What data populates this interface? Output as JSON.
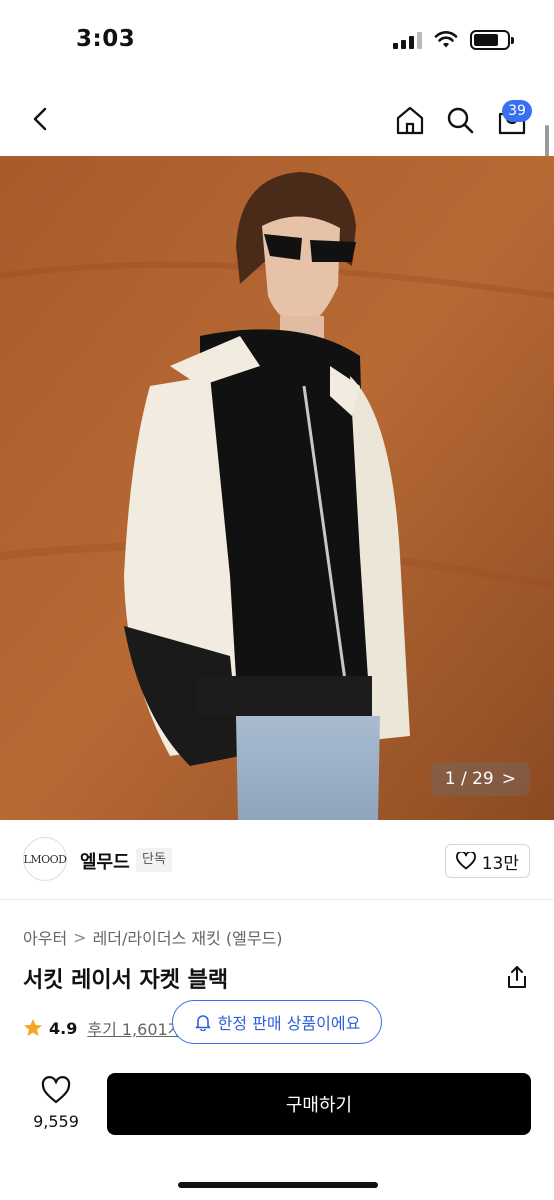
{
  "status_bar": {
    "time": "3:03"
  },
  "nav": {
    "cart_count": "39"
  },
  "image": {
    "counter": "1 / 29",
    "counter_arrow": ">"
  },
  "brand": {
    "name": "엘무드",
    "tag": "단독",
    "likes": "13만",
    "logo_text": "LMOOD"
  },
  "breadcrumb": {
    "category": "아우터",
    "separator": ">",
    "subcategory": "레더/라이더스 재킷 (엘무드)"
  },
  "product": {
    "title": "서킷 레이서 자켓 블랙",
    "rating": "4.9",
    "reviews": "후기 1,601개"
  },
  "toast": {
    "text": "한정 판매 상품이에요"
  },
  "bottom_bar": {
    "wishlist_count": "9,559",
    "buy_label": "구매하기"
  },
  "colors": {
    "accent": "#3a6ff0",
    "star": "#f5a623",
    "buy_bg": "#000000"
  }
}
